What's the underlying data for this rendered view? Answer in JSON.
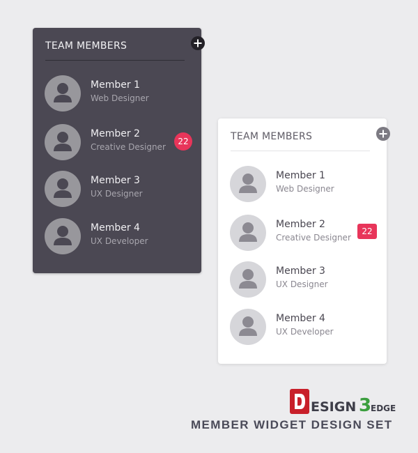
{
  "dark_widget": {
    "title": "TEAM MEMBERS",
    "members": [
      {
        "name": "Member 1",
        "role": "Web Designer"
      },
      {
        "name": "Member 2",
        "role": "Creative Designer",
        "badge": "22"
      },
      {
        "name": "Member 3",
        "role": "UX Designer"
      },
      {
        "name": "Member 4",
        "role": "UX Developer"
      }
    ]
  },
  "light_widget": {
    "title": "TEAM MEMBERS",
    "members": [
      {
        "name": "Member 1",
        "role": "Web Designer"
      },
      {
        "name": "Member 2",
        "role": "Creative Designer",
        "badge": "22"
      },
      {
        "name": "Member 3",
        "role": "UX Designer"
      },
      {
        "name": "Member 4",
        "role": "UX Developer"
      }
    ]
  },
  "branding": {
    "logo_text": "DESIGN3EDGE",
    "caption": "MEMBER WIDGET DESIGN SET"
  },
  "colors": {
    "dark_card_bg": "#4b4853",
    "light_card_bg": "#ffffff",
    "badge_red": "#e8355a",
    "page_bg": "#ececee"
  },
  "icons": {
    "add": "plus-circle-icon",
    "avatar": "user-silhouette-icon"
  }
}
